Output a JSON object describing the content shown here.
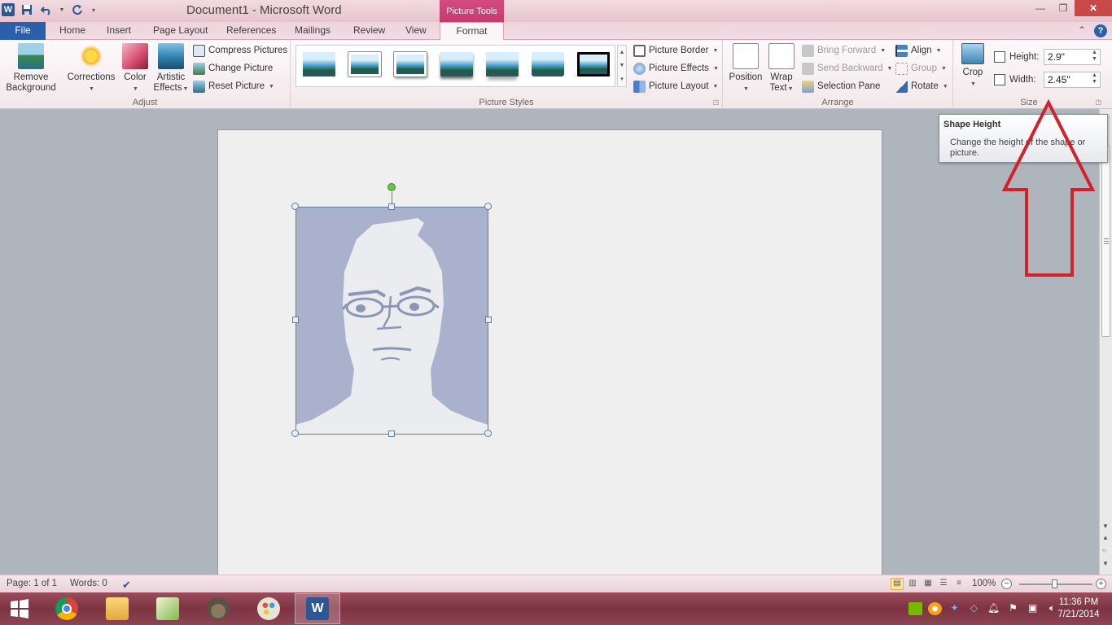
{
  "window": {
    "title": "Document1  -  Microsoft Word",
    "context_tab": "Picture Tools"
  },
  "qat": {
    "app_icon": "W",
    "save_icon": "save-icon",
    "undo_icon": "undo-icon",
    "redo_icon": "redo-icon"
  },
  "tabs": {
    "file": "File",
    "home": "Home",
    "insert": "Insert",
    "page_layout": "Page Layout",
    "references": "References",
    "mailings": "Mailings",
    "review": "Review",
    "view": "View",
    "format": "Format"
  },
  "ribbon": {
    "adjust": {
      "label": "Adjust",
      "remove_background": "Remove Background",
      "corrections": "Corrections",
      "color": "Color",
      "artistic_effects": "Artistic Effects",
      "compress_pictures": "Compress Pictures",
      "change_picture": "Change Picture",
      "reset_picture": "Reset Picture"
    },
    "picture_styles": {
      "label": "Picture Styles",
      "picture_border": "Picture Border",
      "picture_effects": "Picture Effects",
      "picture_layout": "Picture Layout"
    },
    "arrange": {
      "label": "Arrange",
      "position": "Position",
      "wrap_text": "Wrap Text",
      "bring_forward": "Bring Forward",
      "send_backward": "Send Backward",
      "selection_pane": "Selection Pane",
      "align": "Align",
      "group": "Group",
      "rotate": "Rotate"
    },
    "size": {
      "label": "Size",
      "crop": "Crop",
      "height_label": "Height:",
      "height_value": "2.9\"",
      "width_label": "Width:",
      "width_value": "2.45\""
    }
  },
  "tooltip": {
    "title": "Shape Height",
    "body": "Change the height of the shape or picture."
  },
  "statusbar": {
    "page": "Page: 1 of 1",
    "words": "Words: 0",
    "zoom": "100%",
    "zoom_level": 1.0
  },
  "clock": {
    "time": "11:36 PM",
    "date": "7/21/2014"
  },
  "colors": {
    "accent": "#c63b6e",
    "file_tab": "#2b5faa",
    "annotation_arrow": "#d4202a"
  }
}
